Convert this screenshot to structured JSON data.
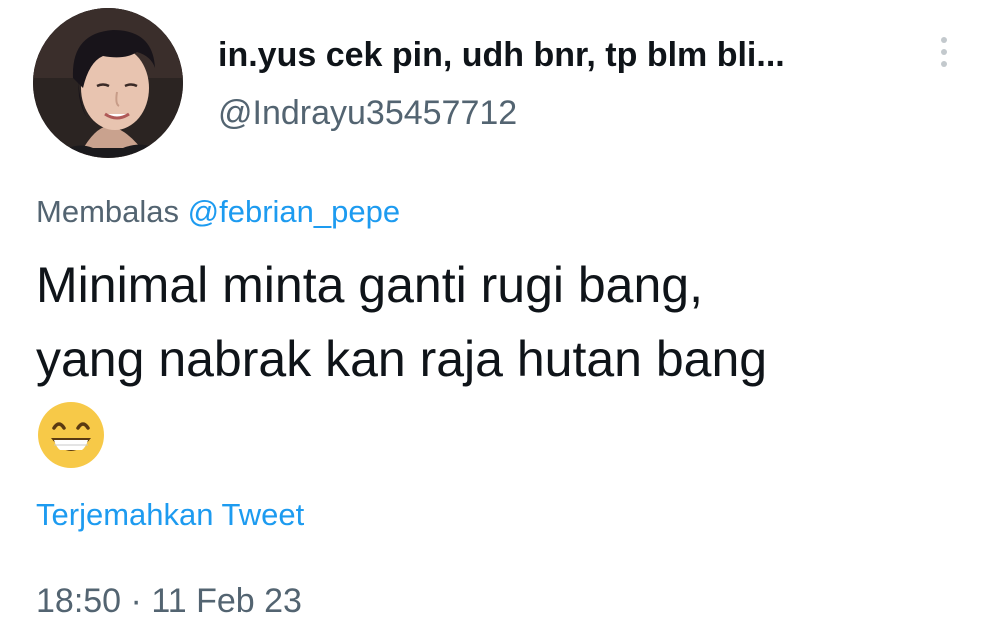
{
  "tweet": {
    "author": {
      "display_name": "in.yus cek pin, udh bnr, tp blm bli...",
      "handle": "@Indrayu35457712",
      "avatar": "profile-photo"
    },
    "more_icon": "vertical-ellipsis-icon",
    "reply_context": {
      "prefix": "Membalas",
      "mention": "@febrian_pepe"
    },
    "text_lines": [
      "Minimal minta ganti rugi bang,",
      "yang nabrak kan raja hutan bang"
    ],
    "emoji": "grinning-face-with-smiling-eyes",
    "translate_label": "Terjemahkan Tweet",
    "timestamp": {
      "time": "18:50",
      "separator": "·",
      "date": "11 Feb 23"
    }
  },
  "colors": {
    "text_primary": "#0f1419",
    "text_secondary": "#536471",
    "link": "#1d9bf0",
    "more_dots": "#c3c9cd"
  }
}
